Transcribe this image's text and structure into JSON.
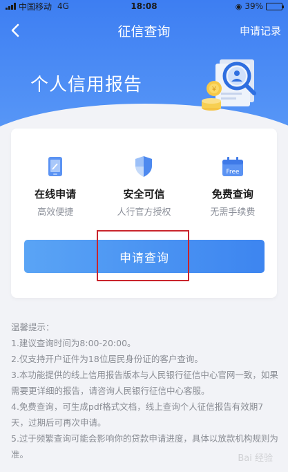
{
  "status_bar": {
    "carrier": "中国移动",
    "network": "4G",
    "time": "18:08",
    "battery_percent": "39%",
    "battery_level": 0.39
  },
  "nav": {
    "title": "征信查询",
    "right_action": "申请记录"
  },
  "hero": {
    "title": "个人信用报告"
  },
  "features": [
    {
      "title": "在线申请",
      "subtitle": "高效便捷",
      "icon": "phone-icon"
    },
    {
      "title": "安全可信",
      "subtitle": "人行官方授权",
      "icon": "shield-icon"
    },
    {
      "title": "免费查询",
      "subtitle": "无需手续费",
      "icon": "free-calendar-icon",
      "badge": "Free"
    }
  ],
  "apply_button_label": "申请查询",
  "tips": {
    "heading": "温馨提示：",
    "items": [
      "1.建议查询时间为8:00-20:00。",
      "2.仅支持开户证件为18位居民身份证的客户查询。",
      "3.本功能提供的线上信用报告版本与人民银行征信中心官网一致，如果需要更详细的报告，请咨询人民银行征信中心客服。",
      "4.免费查询，可生成pdf格式文档，线上查询个人征信报告有效期7天，过期后可再次申请。",
      "5.过于频繁查询可能会影响你的贷款申请进度，具体以放款机构规则为准。"
    ]
  },
  "watermark": "Bai 经验",
  "colors": {
    "primary": "#3d7ef2",
    "highlight_border": "#c9242b"
  }
}
